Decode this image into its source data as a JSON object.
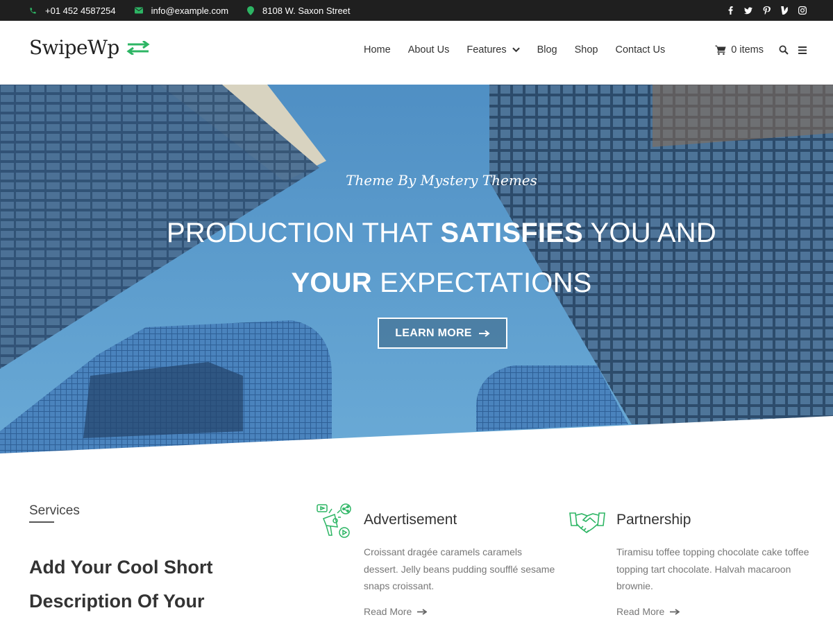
{
  "topbar": {
    "phone": "+01 452 4587254",
    "email": "info@example.com",
    "address": "8108 W. Saxon Street",
    "social_icons": [
      "facebook-icon",
      "twitter-icon",
      "pinterest-icon",
      "vine-icon",
      "instagram-icon"
    ]
  },
  "header": {
    "logo": "SwipeWp",
    "nav": [
      {
        "label": "Home"
      },
      {
        "label": "About Us"
      },
      {
        "label": "Features"
      },
      {
        "label": "Blog"
      },
      {
        "label": "Shop"
      },
      {
        "label": "Contact Us"
      }
    ],
    "cart_label": "0 items"
  },
  "hero": {
    "subtitle": "Theme By Mystery Themes",
    "title_line1_a": "PRODUCTION THAT ",
    "title_line1_b": "SATISFIES",
    "title_line1_c": " YOU AND",
    "title_line2_a": "YOUR",
    "title_line2_b": " EXPECTATIONS",
    "button_label": "LEARN MORE"
  },
  "services": {
    "label": "Services",
    "description": "Add Your Cool Short Description Of Your",
    "cards": [
      {
        "icon": "megaphone-icon",
        "title": "Advertisement",
        "text": "Croissant dragée caramels caramels dessert. Jelly beans pudding soufflé sesame snaps croissant.",
        "link": "Read More"
      },
      {
        "icon": "handshake-icon",
        "title": "Partnership",
        "text": "Tiramisu toffee topping chocolate cake toffee topping tart chocolate. Halvah macaroon brownie.",
        "link": "Read More"
      }
    ]
  },
  "colors": {
    "accent": "#2db564",
    "topbar_bg": "#1f1f1f",
    "sky": "#5a9ccb"
  }
}
